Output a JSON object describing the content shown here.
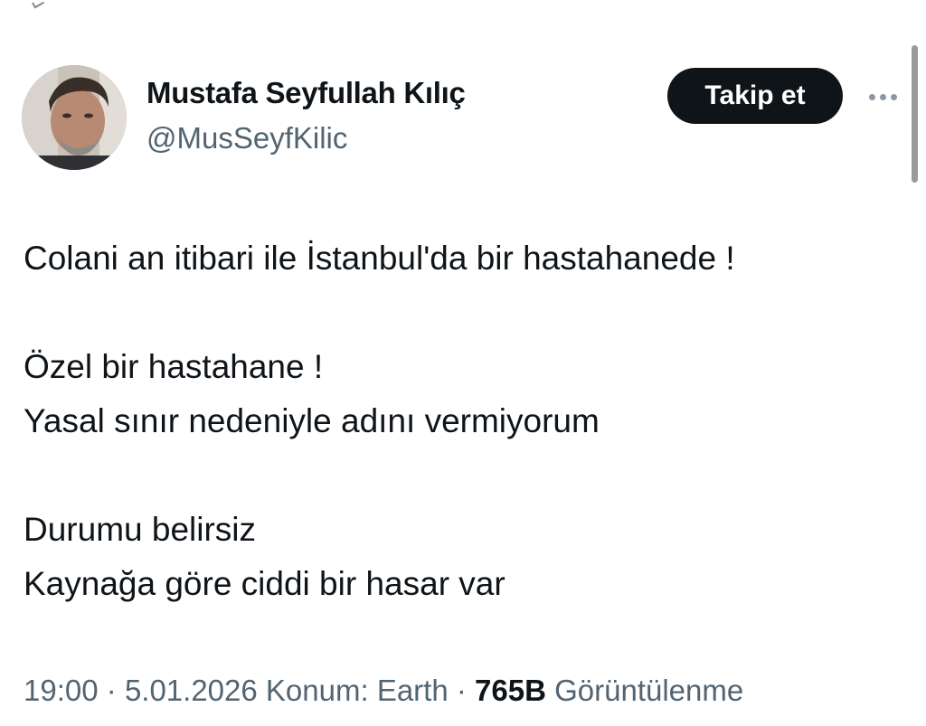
{
  "author": {
    "display_name": "Mustafa Seyfullah Kılıç",
    "handle": "@MusSeyfKilic"
  },
  "actions": {
    "follow_label": "Takip et",
    "more_icon": "more-horizontal-icon"
  },
  "tweet": {
    "lines": [
      "Colani an itibari ile İstanbul'da bir hastahanede !",
      "",
      "Özel bir hastahane !",
      "Yasal sınır nedeniyle adını vermiyorum",
      "",
      "Durumu belirsiz",
      "Kaynağa göre ciddi bir hasar var"
    ]
  },
  "meta": {
    "time": "19:00",
    "separator": "·",
    "date": "5.01.2026",
    "location": "Konum: Earth",
    "views_count": "765B",
    "views_label": "Görüntülenme"
  },
  "colors": {
    "text_primary": "#0f1419",
    "text_secondary": "#536471",
    "button_bg": "#0f1419",
    "button_text": "#ffffff"
  }
}
